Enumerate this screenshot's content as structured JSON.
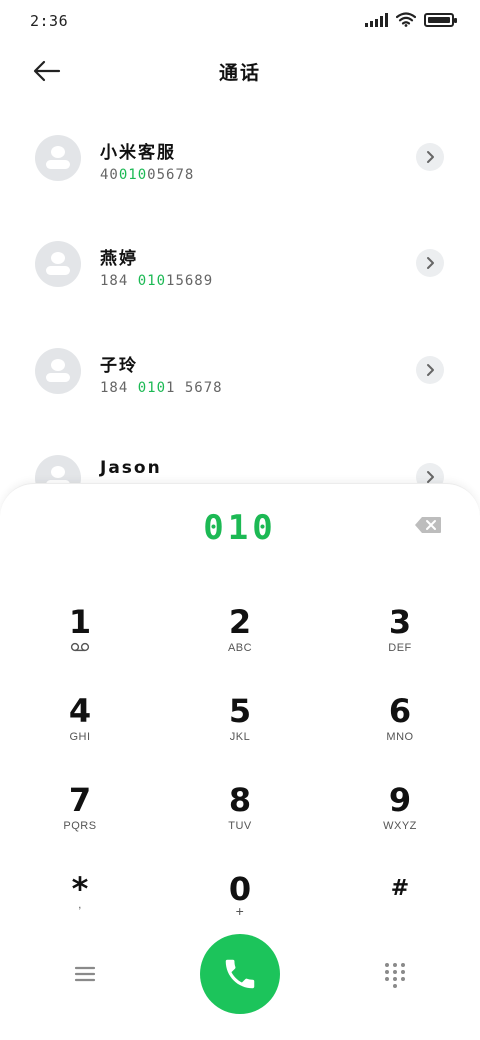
{
  "status_bar": {
    "time": "2:36",
    "icons": [
      "signal-icon",
      "wifi-icon",
      "battery-icon"
    ]
  },
  "header": {
    "title": "通话",
    "back_icon": "back-arrow-icon"
  },
  "contacts": [
    {
      "name": "小米客服",
      "number_pre": "40",
      "number_match": "010",
      "number_post": "05678"
    },
    {
      "name": "燕婷",
      "number_pre": "184 ",
      "number_match": "010",
      "number_post": "15689"
    },
    {
      "name": "子玲",
      "number_pre": "184 ",
      "number_match": "010",
      "number_post": "1 5678"
    },
    {
      "name": "Jason",
      "number_pre": "",
      "number_match": "",
      "number_post": ""
    }
  ],
  "dialpad": {
    "dialed": "010",
    "keys": [
      {
        "digit": "1",
        "letters": ""
      },
      {
        "digit": "2",
        "letters": "ABC"
      },
      {
        "digit": "3",
        "letters": "DEF"
      },
      {
        "digit": "4",
        "letters": "GHI"
      },
      {
        "digit": "5",
        "letters": "JKL"
      },
      {
        "digit": "6",
        "letters": "MNO"
      },
      {
        "digit": "7",
        "letters": "PQRS"
      },
      {
        "digit": "8",
        "letters": "TUV"
      },
      {
        "digit": "9",
        "letters": "WXYZ"
      },
      {
        "digit": "*",
        "letters": ","
      },
      {
        "digit": "0",
        "letters": "+"
      },
      {
        "digit": "#",
        "letters": ""
      }
    ]
  },
  "colors": {
    "accent": "#1cb954",
    "call_button": "#1cc45b",
    "avatar_bg": "#e3e5e8"
  }
}
